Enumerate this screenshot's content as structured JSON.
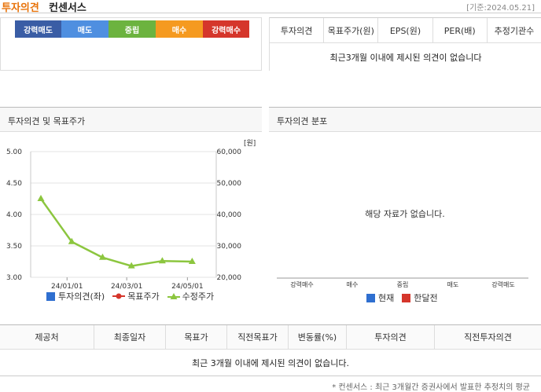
{
  "header": {
    "title_a": "투자의견",
    "title_b": "컨센서스",
    "date_text": "[기준:2024.05.21]"
  },
  "scale": {
    "items": [
      {
        "label": "강력매도",
        "color": "#3a5da5"
      },
      {
        "label": "매도",
        "color": "#4f8fe0"
      },
      {
        "label": "중립",
        "color": "#6cb33f"
      },
      {
        "label": "매수",
        "color": "#f59a20"
      },
      {
        "label": "강력매수",
        "color": "#d5362b"
      }
    ]
  },
  "opinion_table": {
    "headers": [
      "투자의견",
      "목표주가(원)",
      "EPS(원)",
      "PER(배)",
      "추정기관수"
    ],
    "message": "최근3개월 이내에 제시된 의견이 없습니다"
  },
  "chart_panel": {
    "title": "투자의견 및 목표주가"
  },
  "dist_panel": {
    "title": "투자의견 분포",
    "nodata": "해당 자료가 없습니다.",
    "categories": [
      "강력매수",
      "매수",
      "중립",
      "매도",
      "강력매도"
    ],
    "legend": [
      {
        "label": "현재",
        "color": "#2f6fd0"
      },
      {
        "label": "한달전",
        "color": "#d5362b"
      }
    ]
  },
  "chart_data": {
    "type": "line",
    "x_ticks": [
      "24/01/01",
      "24/03/01",
      "24/05/01"
    ],
    "y_left": {
      "ticks": [
        "5.00",
        "4.50",
        "4.00",
        "3.50",
        "3.00"
      ],
      "range": [
        3.0,
        5.0
      ]
    },
    "y_right": {
      "ticks": [
        "60,000",
        "50,000",
        "40,000",
        "30,000",
        "20,000"
      ],
      "range": [
        20000,
        60000
      ],
      "unit": "[원]"
    },
    "series": [
      {
        "name": "투자의견(좌)",
        "axis": "left",
        "color": "#2f6fd0",
        "values": []
      },
      {
        "name": "목표주가",
        "axis": "right",
        "color": "#d5362b",
        "values": []
      },
      {
        "name": "수정주가",
        "axis": "right",
        "color": "#8cc63f",
        "points": [
          {
            "date": "2023-12-01",
            "value": 45000
          },
          {
            "date": "2024-01-01",
            "value": 31300
          },
          {
            "date": "2024-02-01",
            "value": 26300
          },
          {
            "date": "2024-03-01",
            "value": 23600
          },
          {
            "date": "2024-04-01",
            "value": 25200
          },
          {
            "date": "2024-05-01",
            "value": 25000
          }
        ]
      }
    ]
  },
  "bottom_table": {
    "headers": [
      "제공처",
      "최종일자",
      "목표가",
      "직전목표가",
      "변동률(%)",
      "투자의견",
      "직전투자의견"
    ],
    "message": "최근 3개월 이내에 제시된 의견이 없습니다."
  },
  "footnote": "* 컨센서스 : 최근 3개월간 증권사에서 발표한 추정치의 평균"
}
